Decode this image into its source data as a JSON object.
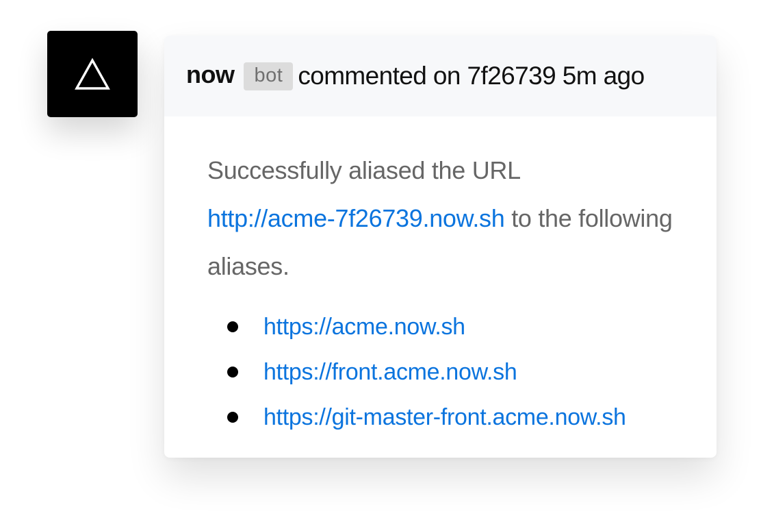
{
  "avatar": {
    "icon": "triangle-icon",
    "background": "#000000",
    "foreground": "#ffffff"
  },
  "comment": {
    "author": "now",
    "badge": "bot",
    "action": "commented on 7f26739 5m ago",
    "message": {
      "text_before": "Successfully aliased the URL",
      "url": "http://acme-7f26739.now.sh",
      "text_after": "to the following aliases."
    },
    "aliases": [
      "https://acme.now.sh",
      "https://front.acme.now.sh",
      "https://git-master-front.acme.now.sh"
    ]
  },
  "colors": {
    "link": "#0b74de",
    "body_text": "#666666",
    "header_bg": "#f7f8fa",
    "badge_bg": "#dcdcdc"
  }
}
